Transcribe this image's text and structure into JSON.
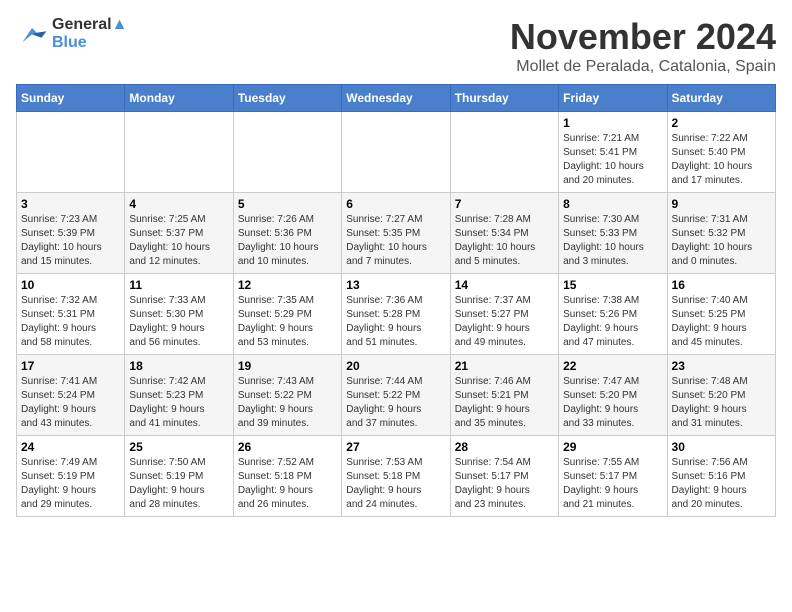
{
  "logo": {
    "line1": "General",
    "line2": "Blue"
  },
  "title": "November 2024",
  "subtitle": "Mollet de Peralada, Catalonia, Spain",
  "weekdays": [
    "Sunday",
    "Monday",
    "Tuesday",
    "Wednesday",
    "Thursday",
    "Friday",
    "Saturday"
  ],
  "weeks": [
    [
      {
        "day": "",
        "info": ""
      },
      {
        "day": "",
        "info": ""
      },
      {
        "day": "",
        "info": ""
      },
      {
        "day": "",
        "info": ""
      },
      {
        "day": "",
        "info": ""
      },
      {
        "day": "1",
        "info": "Sunrise: 7:21 AM\nSunset: 5:41 PM\nDaylight: 10 hours\nand 20 minutes."
      },
      {
        "day": "2",
        "info": "Sunrise: 7:22 AM\nSunset: 5:40 PM\nDaylight: 10 hours\nand 17 minutes."
      }
    ],
    [
      {
        "day": "3",
        "info": "Sunrise: 7:23 AM\nSunset: 5:39 PM\nDaylight: 10 hours\nand 15 minutes."
      },
      {
        "day": "4",
        "info": "Sunrise: 7:25 AM\nSunset: 5:37 PM\nDaylight: 10 hours\nand 12 minutes."
      },
      {
        "day": "5",
        "info": "Sunrise: 7:26 AM\nSunset: 5:36 PM\nDaylight: 10 hours\nand 10 minutes."
      },
      {
        "day": "6",
        "info": "Sunrise: 7:27 AM\nSunset: 5:35 PM\nDaylight: 10 hours\nand 7 minutes."
      },
      {
        "day": "7",
        "info": "Sunrise: 7:28 AM\nSunset: 5:34 PM\nDaylight: 10 hours\nand 5 minutes."
      },
      {
        "day": "8",
        "info": "Sunrise: 7:30 AM\nSunset: 5:33 PM\nDaylight: 10 hours\nand 3 minutes."
      },
      {
        "day": "9",
        "info": "Sunrise: 7:31 AM\nSunset: 5:32 PM\nDaylight: 10 hours\nand 0 minutes."
      }
    ],
    [
      {
        "day": "10",
        "info": "Sunrise: 7:32 AM\nSunset: 5:31 PM\nDaylight: 9 hours\nand 58 minutes."
      },
      {
        "day": "11",
        "info": "Sunrise: 7:33 AM\nSunset: 5:30 PM\nDaylight: 9 hours\nand 56 minutes."
      },
      {
        "day": "12",
        "info": "Sunrise: 7:35 AM\nSunset: 5:29 PM\nDaylight: 9 hours\nand 53 minutes."
      },
      {
        "day": "13",
        "info": "Sunrise: 7:36 AM\nSunset: 5:28 PM\nDaylight: 9 hours\nand 51 minutes."
      },
      {
        "day": "14",
        "info": "Sunrise: 7:37 AM\nSunset: 5:27 PM\nDaylight: 9 hours\nand 49 minutes."
      },
      {
        "day": "15",
        "info": "Sunrise: 7:38 AM\nSunset: 5:26 PM\nDaylight: 9 hours\nand 47 minutes."
      },
      {
        "day": "16",
        "info": "Sunrise: 7:40 AM\nSunset: 5:25 PM\nDaylight: 9 hours\nand 45 minutes."
      }
    ],
    [
      {
        "day": "17",
        "info": "Sunrise: 7:41 AM\nSunset: 5:24 PM\nDaylight: 9 hours\nand 43 minutes."
      },
      {
        "day": "18",
        "info": "Sunrise: 7:42 AM\nSunset: 5:23 PM\nDaylight: 9 hours\nand 41 minutes."
      },
      {
        "day": "19",
        "info": "Sunrise: 7:43 AM\nSunset: 5:22 PM\nDaylight: 9 hours\nand 39 minutes."
      },
      {
        "day": "20",
        "info": "Sunrise: 7:44 AM\nSunset: 5:22 PM\nDaylight: 9 hours\nand 37 minutes."
      },
      {
        "day": "21",
        "info": "Sunrise: 7:46 AM\nSunset: 5:21 PM\nDaylight: 9 hours\nand 35 minutes."
      },
      {
        "day": "22",
        "info": "Sunrise: 7:47 AM\nSunset: 5:20 PM\nDaylight: 9 hours\nand 33 minutes."
      },
      {
        "day": "23",
        "info": "Sunrise: 7:48 AM\nSunset: 5:20 PM\nDaylight: 9 hours\nand 31 minutes."
      }
    ],
    [
      {
        "day": "24",
        "info": "Sunrise: 7:49 AM\nSunset: 5:19 PM\nDaylight: 9 hours\nand 29 minutes."
      },
      {
        "day": "25",
        "info": "Sunrise: 7:50 AM\nSunset: 5:19 PM\nDaylight: 9 hours\nand 28 minutes."
      },
      {
        "day": "26",
        "info": "Sunrise: 7:52 AM\nSunset: 5:18 PM\nDaylight: 9 hours\nand 26 minutes."
      },
      {
        "day": "27",
        "info": "Sunrise: 7:53 AM\nSunset: 5:18 PM\nDaylight: 9 hours\nand 24 minutes."
      },
      {
        "day": "28",
        "info": "Sunrise: 7:54 AM\nSunset: 5:17 PM\nDaylight: 9 hours\nand 23 minutes."
      },
      {
        "day": "29",
        "info": "Sunrise: 7:55 AM\nSunset: 5:17 PM\nDaylight: 9 hours\nand 21 minutes."
      },
      {
        "day": "30",
        "info": "Sunrise: 7:56 AM\nSunset: 5:16 PM\nDaylight: 9 hours\nand 20 minutes."
      }
    ]
  ]
}
